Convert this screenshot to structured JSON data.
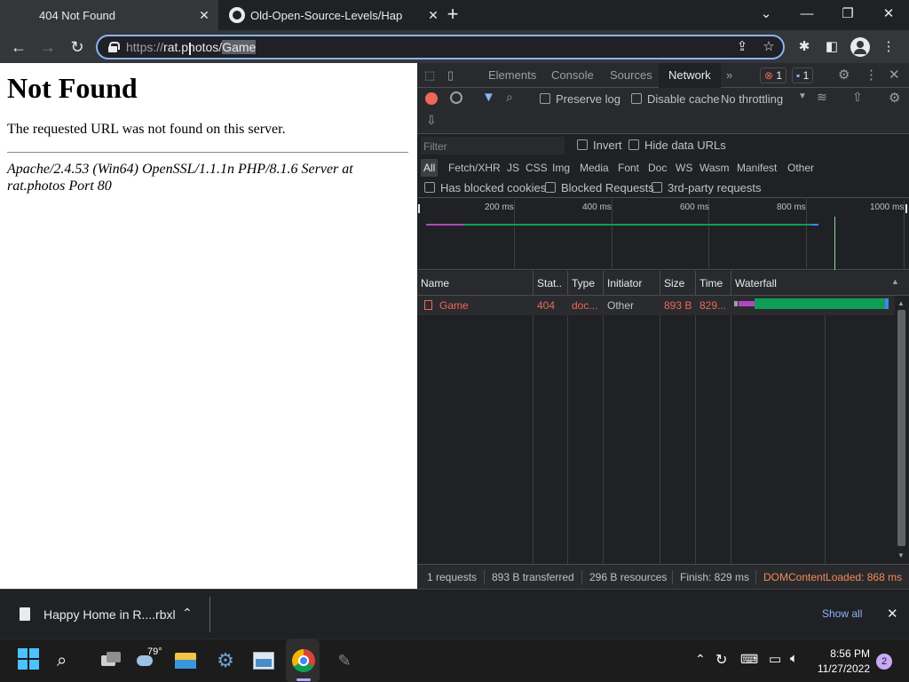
{
  "browser": {
    "tabs": [
      {
        "label": "404 Not Found",
        "active": true
      },
      {
        "label": "Old-Open-Source-Levels/Happy",
        "active": false
      }
    ],
    "url": {
      "scheme": "https://",
      "host": "rat.photos/",
      "path": "Game"
    }
  },
  "page": {
    "heading": "Not Found",
    "message": "The requested URL was not found on this server.",
    "address": "Apache/2.4.53 (Win64) OpenSSL/1.1.1n PHP/8.1.6 Server at rat.photos Port 80"
  },
  "devtools": {
    "tabs": [
      "Elements",
      "Console",
      "Sources",
      "Network"
    ],
    "active_tab": "Network",
    "error_count": "1",
    "message_count": "1",
    "toolbar": {
      "preserve_log": "Preserve log",
      "disable_cache": "Disable cache",
      "throttling": "No throttling"
    },
    "filter": {
      "placeholder": "Filter",
      "invert": "Invert",
      "hide_data_urls": "Hide data URLs",
      "types": [
        "All",
        "Fetch/XHR",
        "JS",
        "CSS",
        "Img",
        "Media",
        "Font",
        "Doc",
        "WS",
        "Wasm",
        "Manifest",
        "Other"
      ],
      "has_blocked_cookies": "Has blocked cookies",
      "blocked_requests": "Blocked Requests",
      "third_party": "3rd-party requests"
    },
    "overview_ticks": [
      "200 ms",
      "400 ms",
      "600 ms",
      "800 ms",
      "1000 ms"
    ],
    "columns": [
      "Name",
      "Stat..",
      "Type",
      "Initiator",
      "Size",
      "Time",
      "Waterfall"
    ],
    "rows": [
      {
        "name": "Game",
        "status": "404",
        "type": "doc...",
        "initiator": "Other",
        "size": "893 B",
        "time": "829..."
      }
    ],
    "status": {
      "requests": "1 requests",
      "transferred": "893 B transferred",
      "resources": "296 B resources",
      "finish": "Finish: 829 ms",
      "dcl": "DOMContentLoaded: 868 ms"
    }
  },
  "download_shelf": {
    "item": "Happy Home in R....rbxl",
    "show_all": "Show all"
  },
  "taskbar": {
    "weather": "79°",
    "time": "8:56 PM",
    "date": "11/27/2022",
    "notification_count": "2"
  }
}
